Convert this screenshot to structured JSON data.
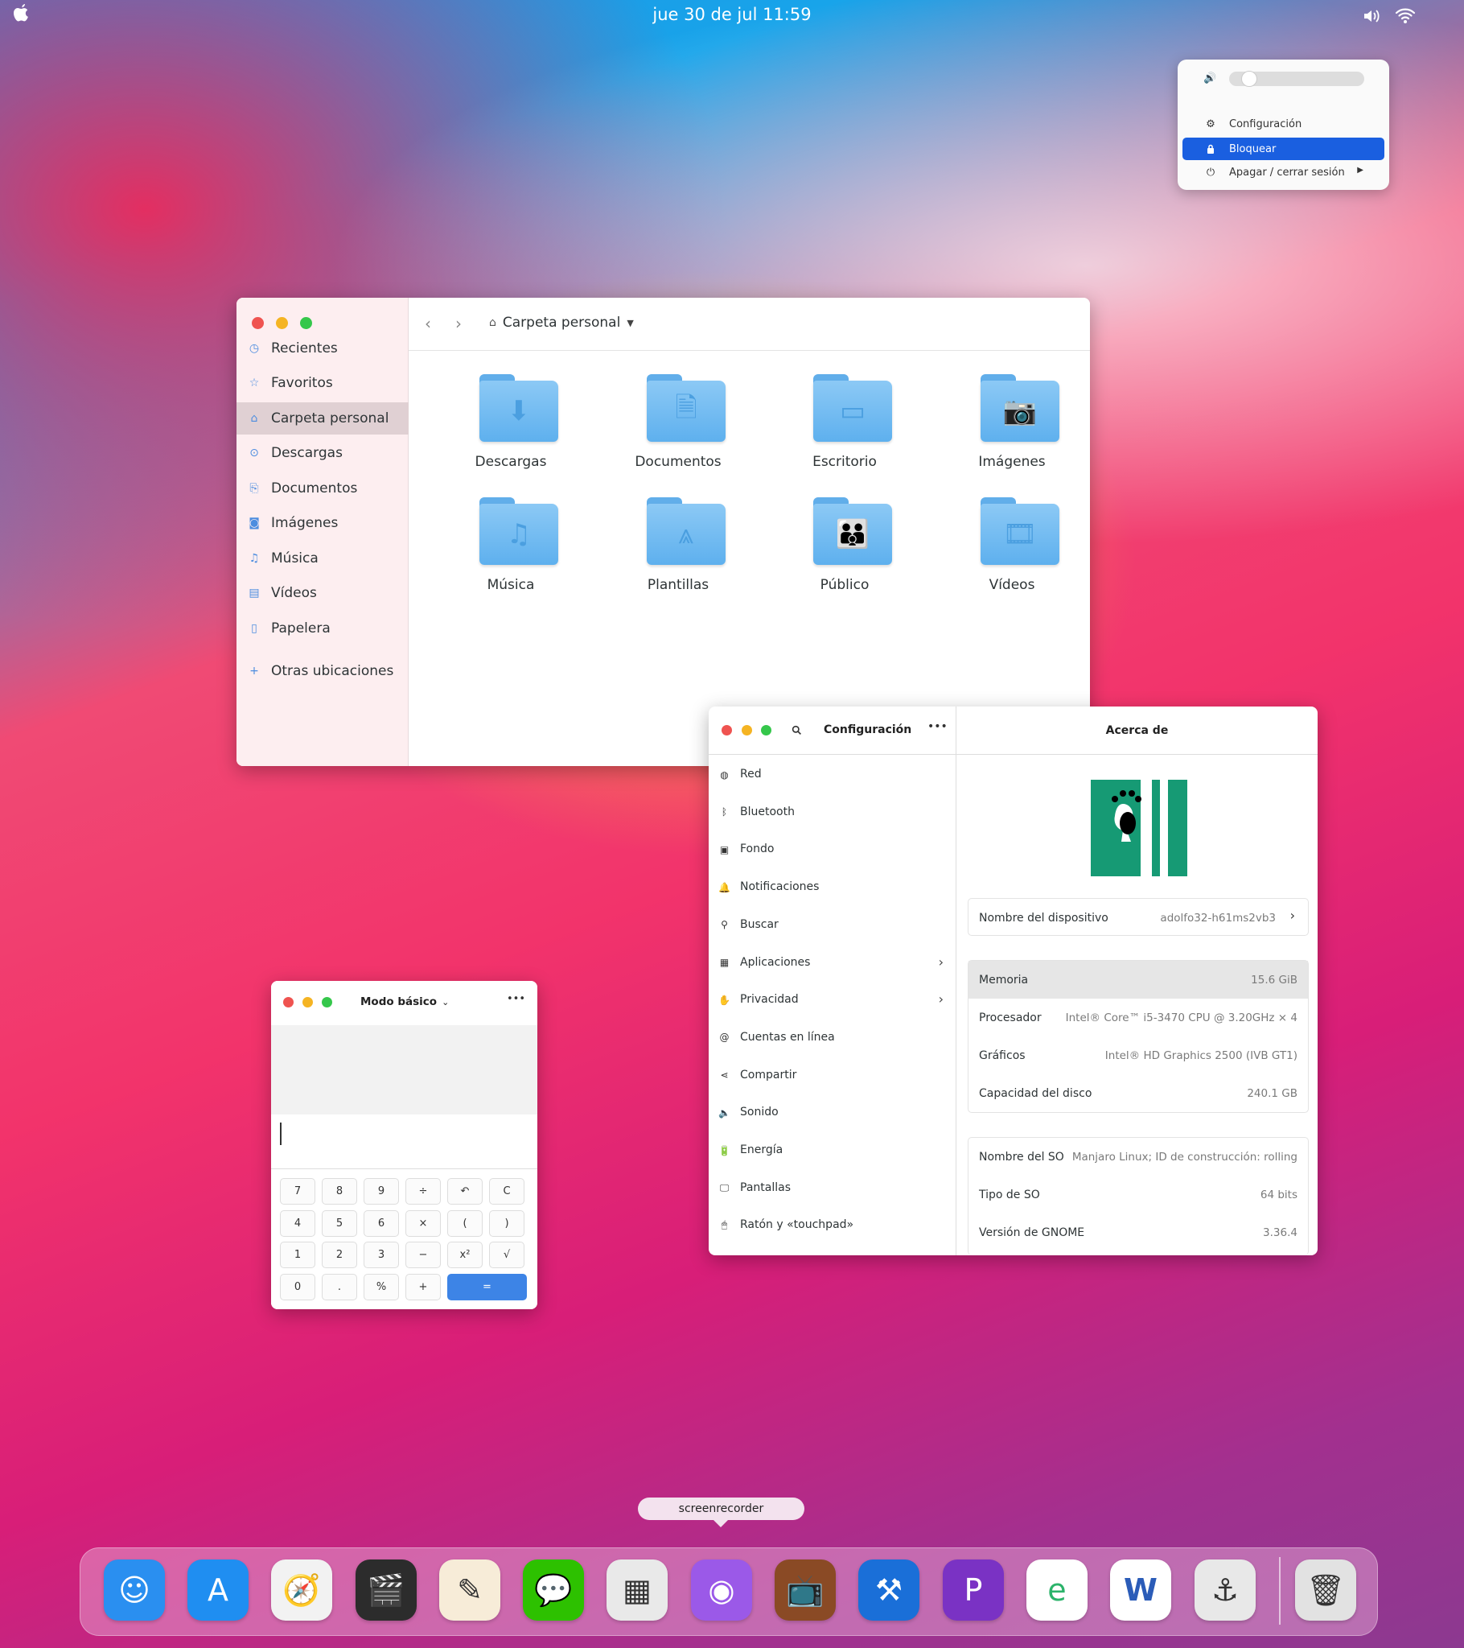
{
  "topbar": {
    "clock": "jue 30 de jul 11:59"
  },
  "system_menu": {
    "volume_level": 0.1,
    "items": [
      {
        "label": "Configuración",
        "icon": "gear-icon"
      },
      {
        "label": "Bloquear",
        "icon": "lock-icon",
        "selected": true
      },
      {
        "label": "Apagar / cerrar sesión",
        "icon": "power-icon"
      }
    ]
  },
  "files": {
    "location": "Carpeta personal",
    "sidebar": [
      {
        "label": "Recientes",
        "icon": "clock-icon"
      },
      {
        "label": "Favoritos",
        "icon": "star-icon"
      },
      {
        "label": "Carpeta personal",
        "icon": "home-icon",
        "selected": true
      },
      {
        "label": "Descargas",
        "icon": "download-icon"
      },
      {
        "label": "Documentos",
        "icon": "document-icon"
      },
      {
        "label": "Imágenes",
        "icon": "camera-icon"
      },
      {
        "label": "Música",
        "icon": "music-icon"
      },
      {
        "label": "Vídeos",
        "icon": "film-icon"
      },
      {
        "label": "Papelera",
        "icon": "trash-icon"
      },
      {
        "label": "Otras ubicaciones",
        "icon": "plus-icon"
      }
    ],
    "folders": [
      {
        "label": "Descargas",
        "glyph": "⬇"
      },
      {
        "label": "Documentos",
        "glyph": "🗎"
      },
      {
        "label": "Escritorio",
        "glyph": "▭"
      },
      {
        "label": "Imágenes",
        "glyph": "📷"
      },
      {
        "label": "Música",
        "glyph": "♫"
      },
      {
        "label": "Plantillas",
        "glyph": "⩓"
      },
      {
        "label": "Público",
        "glyph": "👪"
      },
      {
        "label": "Vídeos",
        "glyph": "🎞"
      }
    ]
  },
  "settings": {
    "title": "Configuración",
    "panel_title": "Acerca de",
    "items": [
      {
        "label": "Red",
        "glyph": "◍"
      },
      {
        "label": "Bluetooth",
        "glyph": "ᛒ"
      },
      {
        "label": "Fondo",
        "glyph": "▣"
      },
      {
        "label": "Notificaciones",
        "glyph": "🔔"
      },
      {
        "label": "Buscar",
        "glyph": "⚲"
      },
      {
        "label": "Aplicaciones",
        "glyph": "▦",
        "chevron": true
      },
      {
        "label": "Privacidad",
        "glyph": "✋",
        "chevron": true
      },
      {
        "label": "Cuentas en línea",
        "glyph": "@"
      },
      {
        "label": "Compartir",
        "glyph": "⋖"
      },
      {
        "label": "Sonido",
        "glyph": "🔈"
      },
      {
        "label": "Energía",
        "glyph": "🔋"
      },
      {
        "label": "Pantallas",
        "glyph": "🖵"
      },
      {
        "label": "Ratón y «touchpad»",
        "glyph": "🖱"
      }
    ],
    "device": {
      "key": "Nombre del dispositivo",
      "value": "adolfo32-h61ms2vb3"
    },
    "hardware": [
      {
        "key": "Memoria",
        "value": "15.6 GiB"
      },
      {
        "key": "Procesador",
        "value": "Intel® Core™ i5-3470 CPU @ 3.20GHz × 4"
      },
      {
        "key": "Gráficos",
        "value": "Intel® HD Graphics 2500 (IVB GT1)"
      },
      {
        "key": "Capacidad del disco",
        "value": "240.1 GB"
      }
    ],
    "os": [
      {
        "key": "Nombre del SO",
        "value": "Manjaro Linux; ID de construcción: rolling"
      },
      {
        "key": "Tipo de SO",
        "value": "64 bits"
      },
      {
        "key": "Versión de GNOME",
        "value": "3.36.4"
      }
    ]
  },
  "calculator": {
    "mode": "Modo básico",
    "keys": [
      [
        "7",
        "8",
        "9",
        "÷",
        "↶",
        "C"
      ],
      [
        "4",
        "5",
        "6",
        "×",
        "(",
        ")"
      ],
      [
        "1",
        "2",
        "3",
        "−",
        "x²",
        "√"
      ],
      [
        "0",
        ".",
        "%",
        "+",
        "="
      ]
    ]
  },
  "dock": {
    "tooltip": "screenrecorder",
    "apps": [
      {
        "name": "finder",
        "bg": "#2a8ff0",
        "glyph": "☺"
      },
      {
        "name": "app-store",
        "bg": "#1f8ef1",
        "glyph": "A"
      },
      {
        "name": "safari",
        "bg": "#f2f2f2",
        "glyph": "🧭"
      },
      {
        "name": "final-cut",
        "bg": "#2c2c2c",
        "glyph": "🎬"
      },
      {
        "name": "pages",
        "bg": "#f7ecd8",
        "glyph": "✎"
      },
      {
        "name": "wechat",
        "bg": "#2dc100",
        "glyph": "💬"
      },
      {
        "name": "calculator",
        "bg": "#e9e9e9",
        "glyph": "▦"
      },
      {
        "name": "screenrecorder",
        "bg": "#9b59e8",
        "glyph": "◉"
      },
      {
        "name": "retro-tv",
        "bg": "#8a4a25",
        "glyph": "📺"
      },
      {
        "name": "xcode",
        "bg": "#1a6fd8",
        "glyph": "⚒"
      },
      {
        "name": "pasta",
        "bg": "#7a32c4",
        "glyph": "P"
      },
      {
        "name": "browser",
        "bg": "#ffffff",
        "glyph": "e"
      },
      {
        "name": "word",
        "bg": "#ffffff",
        "glyph": "W"
      },
      {
        "name": "radio",
        "bg": "#e8e8e8",
        "glyph": "⚓"
      },
      {
        "name": "trash",
        "bg": "#e2e2e2",
        "glyph": "🗑"
      }
    ]
  }
}
